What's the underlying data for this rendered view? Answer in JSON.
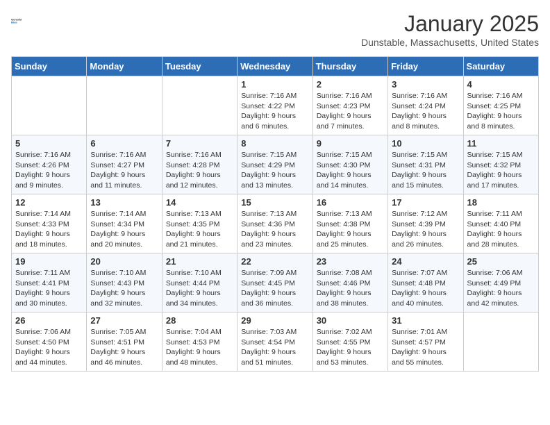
{
  "logo": {
    "line1": "General",
    "line2": "Blue"
  },
  "title": "January 2025",
  "location": "Dunstable, Massachusetts, United States",
  "weekdays": [
    "Sunday",
    "Monday",
    "Tuesday",
    "Wednesday",
    "Thursday",
    "Friday",
    "Saturday"
  ],
  "weeks": [
    [
      {
        "day": "",
        "info": ""
      },
      {
        "day": "",
        "info": ""
      },
      {
        "day": "",
        "info": ""
      },
      {
        "day": "1",
        "info": "Sunrise: 7:16 AM\nSunset: 4:22 PM\nDaylight: 9 hours\nand 6 minutes."
      },
      {
        "day": "2",
        "info": "Sunrise: 7:16 AM\nSunset: 4:23 PM\nDaylight: 9 hours\nand 7 minutes."
      },
      {
        "day": "3",
        "info": "Sunrise: 7:16 AM\nSunset: 4:24 PM\nDaylight: 9 hours\nand 8 minutes."
      },
      {
        "day": "4",
        "info": "Sunrise: 7:16 AM\nSunset: 4:25 PM\nDaylight: 9 hours\nand 8 minutes."
      }
    ],
    [
      {
        "day": "5",
        "info": "Sunrise: 7:16 AM\nSunset: 4:26 PM\nDaylight: 9 hours\nand 9 minutes."
      },
      {
        "day": "6",
        "info": "Sunrise: 7:16 AM\nSunset: 4:27 PM\nDaylight: 9 hours\nand 11 minutes."
      },
      {
        "day": "7",
        "info": "Sunrise: 7:16 AM\nSunset: 4:28 PM\nDaylight: 9 hours\nand 12 minutes."
      },
      {
        "day": "8",
        "info": "Sunrise: 7:15 AM\nSunset: 4:29 PM\nDaylight: 9 hours\nand 13 minutes."
      },
      {
        "day": "9",
        "info": "Sunrise: 7:15 AM\nSunset: 4:30 PM\nDaylight: 9 hours\nand 14 minutes."
      },
      {
        "day": "10",
        "info": "Sunrise: 7:15 AM\nSunset: 4:31 PM\nDaylight: 9 hours\nand 15 minutes."
      },
      {
        "day": "11",
        "info": "Sunrise: 7:15 AM\nSunset: 4:32 PM\nDaylight: 9 hours\nand 17 minutes."
      }
    ],
    [
      {
        "day": "12",
        "info": "Sunrise: 7:14 AM\nSunset: 4:33 PM\nDaylight: 9 hours\nand 18 minutes."
      },
      {
        "day": "13",
        "info": "Sunrise: 7:14 AM\nSunset: 4:34 PM\nDaylight: 9 hours\nand 20 minutes."
      },
      {
        "day": "14",
        "info": "Sunrise: 7:13 AM\nSunset: 4:35 PM\nDaylight: 9 hours\nand 21 minutes."
      },
      {
        "day": "15",
        "info": "Sunrise: 7:13 AM\nSunset: 4:36 PM\nDaylight: 9 hours\nand 23 minutes."
      },
      {
        "day": "16",
        "info": "Sunrise: 7:13 AM\nSunset: 4:38 PM\nDaylight: 9 hours\nand 25 minutes."
      },
      {
        "day": "17",
        "info": "Sunrise: 7:12 AM\nSunset: 4:39 PM\nDaylight: 9 hours\nand 26 minutes."
      },
      {
        "day": "18",
        "info": "Sunrise: 7:11 AM\nSunset: 4:40 PM\nDaylight: 9 hours\nand 28 minutes."
      }
    ],
    [
      {
        "day": "19",
        "info": "Sunrise: 7:11 AM\nSunset: 4:41 PM\nDaylight: 9 hours\nand 30 minutes."
      },
      {
        "day": "20",
        "info": "Sunrise: 7:10 AM\nSunset: 4:43 PM\nDaylight: 9 hours\nand 32 minutes."
      },
      {
        "day": "21",
        "info": "Sunrise: 7:10 AM\nSunset: 4:44 PM\nDaylight: 9 hours\nand 34 minutes."
      },
      {
        "day": "22",
        "info": "Sunrise: 7:09 AM\nSunset: 4:45 PM\nDaylight: 9 hours\nand 36 minutes."
      },
      {
        "day": "23",
        "info": "Sunrise: 7:08 AM\nSunset: 4:46 PM\nDaylight: 9 hours\nand 38 minutes."
      },
      {
        "day": "24",
        "info": "Sunrise: 7:07 AM\nSunset: 4:48 PM\nDaylight: 9 hours\nand 40 minutes."
      },
      {
        "day": "25",
        "info": "Sunrise: 7:06 AM\nSunset: 4:49 PM\nDaylight: 9 hours\nand 42 minutes."
      }
    ],
    [
      {
        "day": "26",
        "info": "Sunrise: 7:06 AM\nSunset: 4:50 PM\nDaylight: 9 hours\nand 44 minutes."
      },
      {
        "day": "27",
        "info": "Sunrise: 7:05 AM\nSunset: 4:51 PM\nDaylight: 9 hours\nand 46 minutes."
      },
      {
        "day": "28",
        "info": "Sunrise: 7:04 AM\nSunset: 4:53 PM\nDaylight: 9 hours\nand 48 minutes."
      },
      {
        "day": "29",
        "info": "Sunrise: 7:03 AM\nSunset: 4:54 PM\nDaylight: 9 hours\nand 51 minutes."
      },
      {
        "day": "30",
        "info": "Sunrise: 7:02 AM\nSunset: 4:55 PM\nDaylight: 9 hours\nand 53 minutes."
      },
      {
        "day": "31",
        "info": "Sunrise: 7:01 AM\nSunset: 4:57 PM\nDaylight: 9 hours\nand 55 minutes."
      },
      {
        "day": "",
        "info": ""
      }
    ]
  ]
}
